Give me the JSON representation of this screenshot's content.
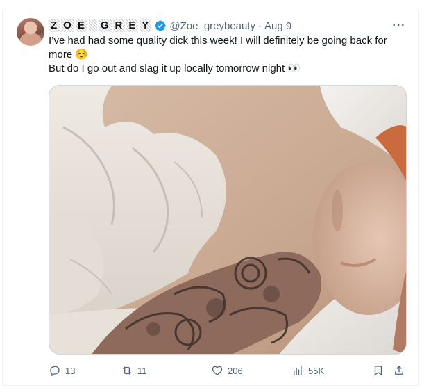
{
  "tweet": {
    "display_name_chars": [
      "Z",
      "O",
      "E",
      " ",
      "G",
      "R",
      "E",
      "Y"
    ],
    "handle": "@Zoe_greybeauty",
    "separator": "·",
    "date": "Aug 9",
    "more_label": "···",
    "text_line1": "I’ve had had some quality dick this week! I will definitely be going back for more ☺️",
    "text_line2": "But do I go out and slag it up locally tomorrow night 👀"
  },
  "actions": {
    "replies": "13",
    "retweets": "11",
    "likes": "206",
    "views": "55K"
  },
  "colors": {
    "verified": "#1d9bf0",
    "secondary_text": "#536471",
    "border": "#cfd9de"
  },
  "icons": [
    "verified-badge-icon",
    "more-icon",
    "reply-icon",
    "retweet-icon",
    "like-icon",
    "views-icon",
    "bookmark-icon",
    "share-icon"
  ]
}
